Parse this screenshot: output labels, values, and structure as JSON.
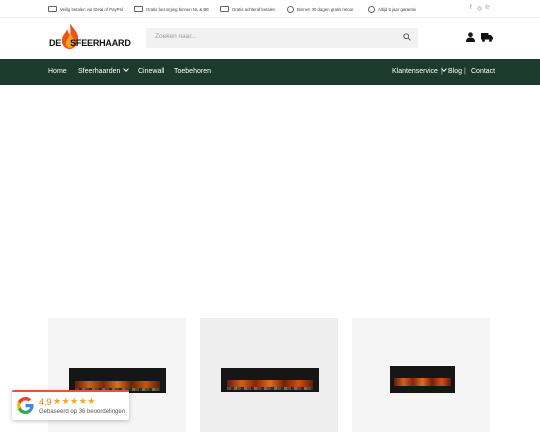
{
  "usp": [
    {
      "icon": "card-icon",
      "text": "Veilig betalen via iDeal of PayPal"
    },
    {
      "icon": "truck-icon",
      "text": "Gratis bezorging binnen NL & BE"
    },
    {
      "icon": "invoice-icon",
      "text": "Gratis achteraf betalen"
    },
    {
      "icon": "return-icon",
      "text": "Binnen 30 dagen gratis retour"
    },
    {
      "icon": "shield-icon",
      "text": "Altijd 5 jaar garantie"
    }
  ],
  "social": {
    "facebook": "f",
    "instagram": "◎",
    "pinterest": "℗"
  },
  "logo": {
    "left": "DE",
    "right": "SFEERHAARD"
  },
  "search": {
    "placeholder": "Zoeken naar..."
  },
  "nav": {
    "home": "Home",
    "sfeerhaarden": "Sfeerhaarden",
    "cinewall": "Cinewall",
    "toebehoren": "Toebehoren",
    "klantenservice": "Klantenservice",
    "sep1": "|",
    "blog": "Blog",
    "sep2": "|",
    "contact": "Contact"
  },
  "review": {
    "score": "4,9",
    "stars": "★★★★★",
    "text": "Gebaseerd op 36 beoordelingen"
  },
  "colors": {
    "nav_bg": "#1c3a2e",
    "star": "#f5a623"
  }
}
